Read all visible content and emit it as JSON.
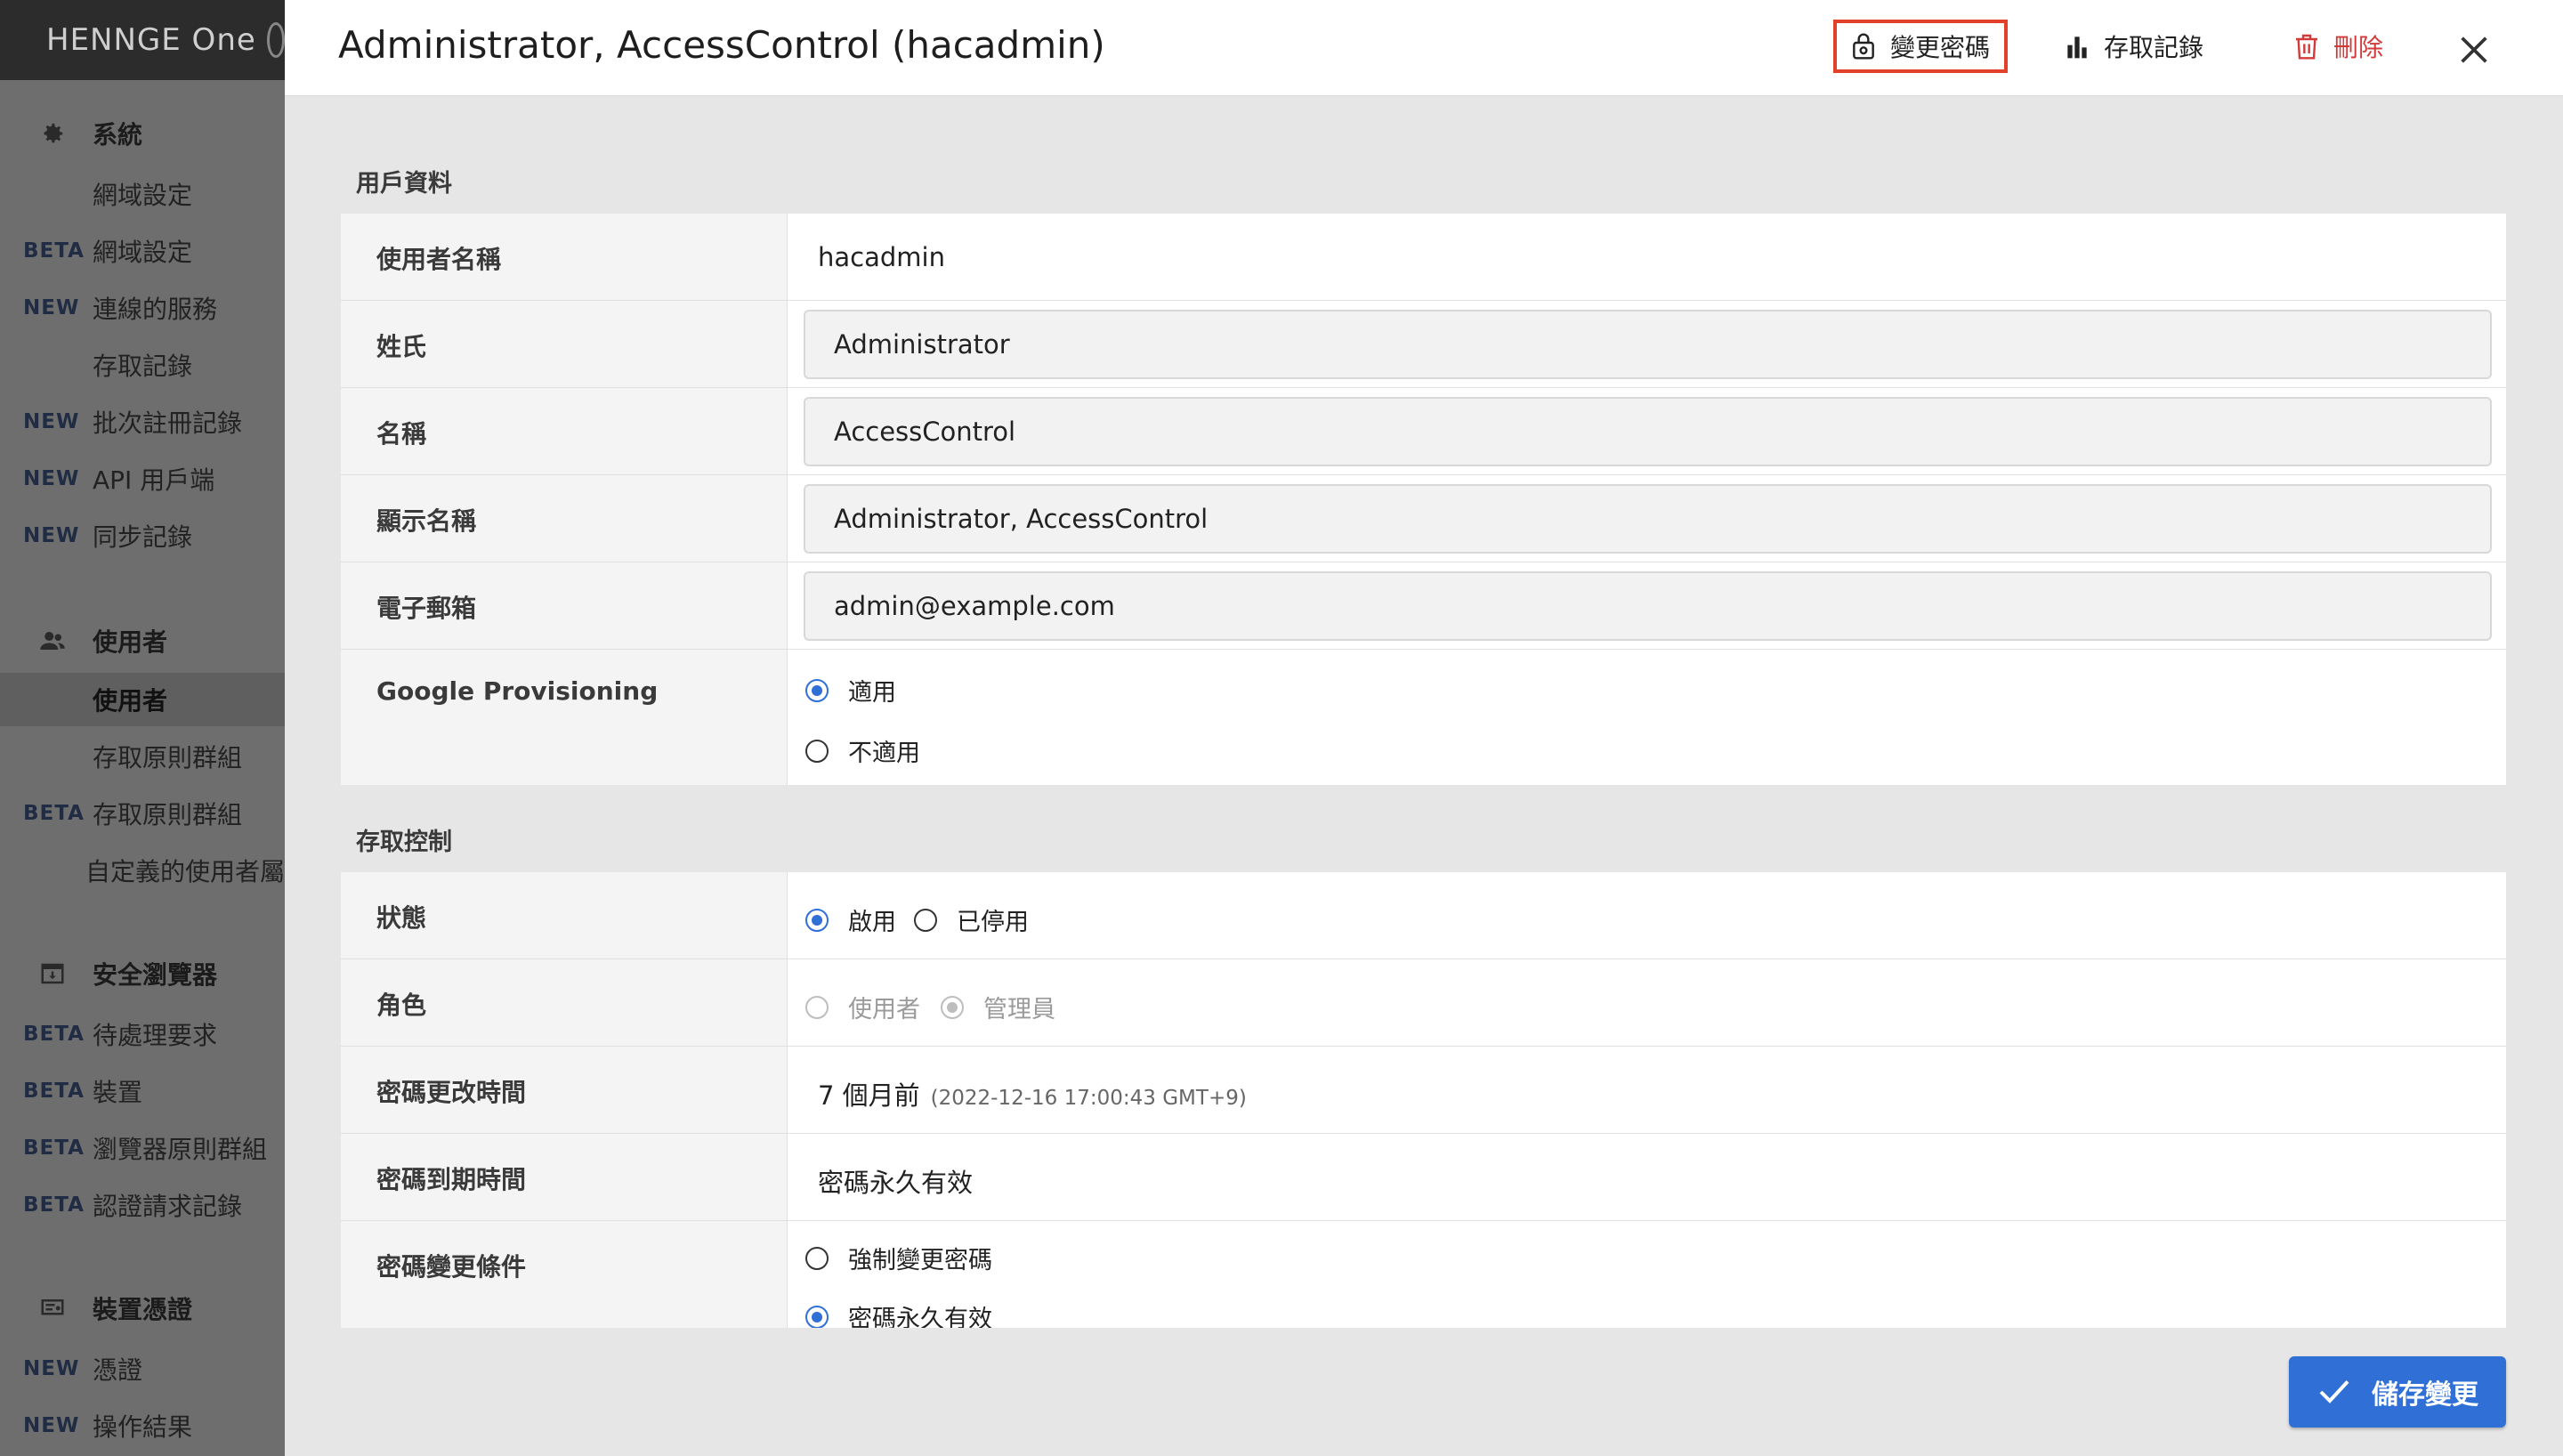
{
  "sidebar": {
    "brand": "HENNGE One",
    "sections": [
      {
        "title": "系統",
        "icon": "gear-icon",
        "items": [
          {
            "tag": "",
            "label": "網域設定"
          },
          {
            "tag": "BETA",
            "label": "網域設定"
          },
          {
            "tag": "NEW",
            "label": "連線的服務"
          },
          {
            "tag": "",
            "label": "存取記錄"
          },
          {
            "tag": "NEW",
            "label": "批次註冊記錄"
          },
          {
            "tag": "NEW",
            "label": "API 用戶端"
          },
          {
            "tag": "NEW",
            "label": "同步記錄"
          }
        ]
      },
      {
        "title": "使用者",
        "icon": "users-icon",
        "items": [
          {
            "tag": "",
            "label": "使用者",
            "active": true
          },
          {
            "tag": "",
            "label": "存取原則群組"
          },
          {
            "tag": "BETA",
            "label": "存取原則群組"
          },
          {
            "tag": "",
            "label": "自定義的使用者屬"
          }
        ]
      },
      {
        "title": "安全瀏覽器",
        "icon": "browser-icon",
        "items": [
          {
            "tag": "BETA",
            "label": "待處理要求"
          },
          {
            "tag": "BETA",
            "label": "裝置"
          },
          {
            "tag": "BETA",
            "label": "瀏覽器原則群組"
          },
          {
            "tag": "BETA",
            "label": "認證請求記錄"
          }
        ]
      },
      {
        "title": "裝置憑證",
        "icon": "certificate-icon",
        "items": [
          {
            "tag": "NEW",
            "label": "憑證"
          },
          {
            "tag": "NEW",
            "label": "操作結果"
          }
        ]
      }
    ]
  },
  "dialog": {
    "title": "Administrator, AccessControl (hacadmin)",
    "actions": {
      "change_password": "變更密碼",
      "access_log": "存取記錄",
      "delete": "刪除"
    },
    "user_info": {
      "section_title": "用戶資料",
      "username_label": "使用者名稱",
      "username_value": "hacadmin",
      "last_name_label": "姓氏",
      "last_name_value": "Administrator",
      "first_name_label": "名稱",
      "first_name_value": "AccessControl",
      "display_name_label": "顯示名稱",
      "display_name_value": "Administrator, AccessControl",
      "email_label": "電子郵箱",
      "email_value": "admin@example.com",
      "google_label": "Google Provisioning",
      "google_options": [
        "適用",
        "不適用"
      ],
      "google_selected": "適用"
    },
    "access_control": {
      "section_title": "存取控制",
      "status_label": "狀態",
      "status_options": [
        "啟用",
        "已停用"
      ],
      "status_selected": "啟用",
      "role_label": "角色",
      "role_options": [
        "使用者",
        "管理員"
      ],
      "role_selected": "管理員",
      "pw_changed_label": "密碼更改時間",
      "pw_changed_value": "7 個月前",
      "pw_changed_detail": "(2022-12-16 17:00:43 GMT+9)",
      "pw_expiry_label": "密碼到期時間",
      "pw_expiry_value": "密碼永久有效",
      "pw_condition_label": "密碼變更條件",
      "pw_condition_options": [
        "強制變更密碼",
        "密碼永久有效"
      ],
      "pw_condition_selected": "密碼永久有效"
    },
    "save_label": "儲存變更"
  },
  "colors": {
    "accent": "#2f6fd6",
    "highlight_border": "#e3402a",
    "danger": "#d23a3a"
  }
}
